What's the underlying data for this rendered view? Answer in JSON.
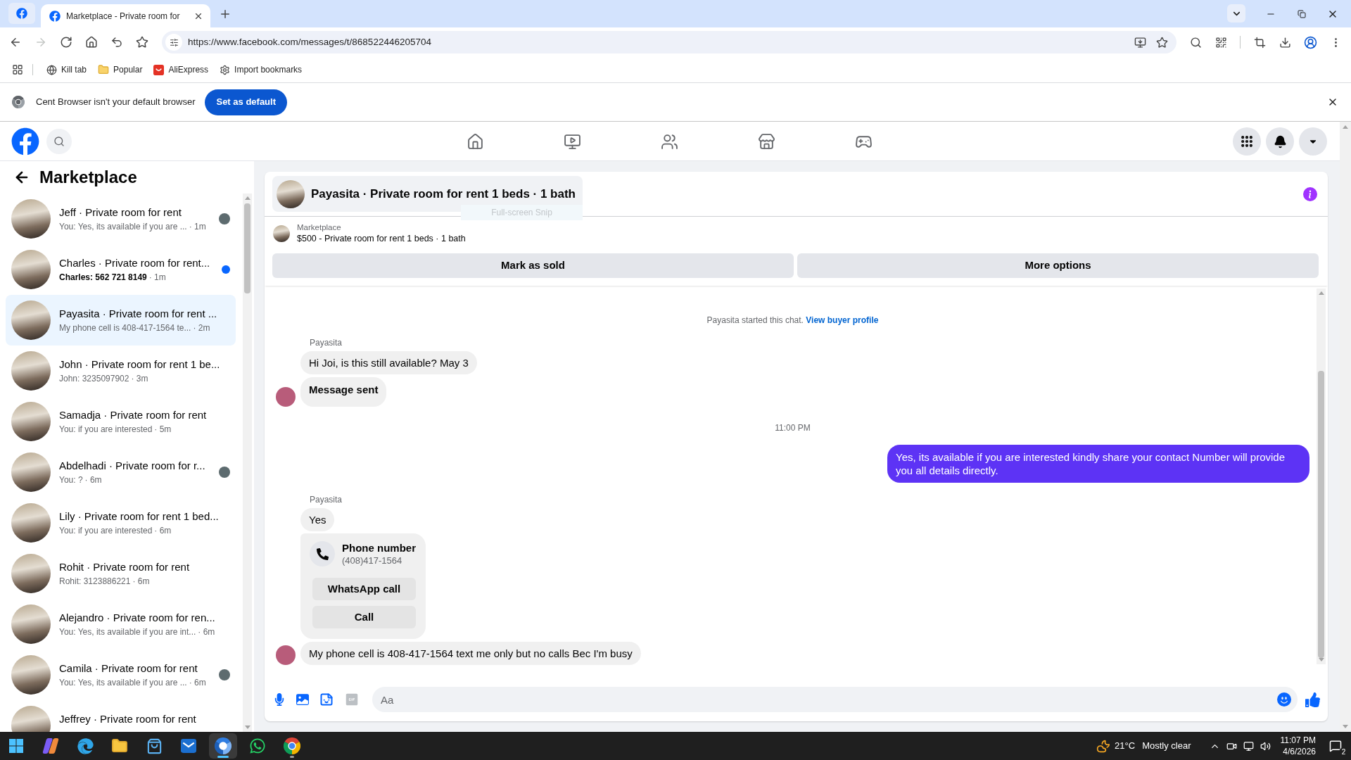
{
  "browser": {
    "tabs": [
      {
        "kind": "pinned",
        "selected": false
      },
      {
        "kind": "page",
        "title": "Marketplace - Private room for",
        "selected": true
      }
    ],
    "navigation": [
      {
        "kind": "back",
        "disabled": false
      },
      {
        "kind": "forward",
        "disabled": true
      },
      {
        "kind": "reload",
        "disabled": false
      },
      {
        "kind": "home",
        "disabled": false
      },
      {
        "kind": "undo",
        "disabled": false
      },
      {
        "kind": "bookmark",
        "disabled": false
      }
    ],
    "url": "https://www.facebook.com/messages/t/868522446205704",
    "bookmarks": [
      {
        "kind": "globe",
        "label": "Kill tab"
      },
      {
        "kind": "folder",
        "label": "Popular"
      },
      {
        "kind": "shop",
        "label": "AliExpress"
      },
      {
        "kind": "gear",
        "label": "Import bookmarks"
      }
    ],
    "infobar": {
      "message": "Cent Browser isn't your default browser",
      "button": "Set as default"
    }
  },
  "facebook_nav": [
    {
      "kind": "home"
    },
    {
      "kind": "video"
    },
    {
      "kind": "friends"
    },
    {
      "kind": "marketplace"
    },
    {
      "kind": "gaming"
    }
  ],
  "sidebar": {
    "title": "Marketplace",
    "conversations": [
      {
        "name": "Jeff · Private room for rent",
        "preview": "You: Yes, its available if you are ...",
        "time": "· 1m",
        "selected": false,
        "unread": false,
        "seen": true
      },
      {
        "name": "Charles · Private room for rent...",
        "preview": "Charles: 562 721 8149",
        "time": "· 1m",
        "selected": false,
        "unread": true,
        "seen": false
      },
      {
        "name": "Payasita · Private room for rent ...",
        "preview": "My phone cell is 408-417-1564 te...",
        "time": "· 2m",
        "selected": true,
        "unread": false,
        "seen": false
      },
      {
        "name": "John · Private room for rent 1 be...",
        "preview": "John: 3235097902",
        "time": "· 3m",
        "selected": false,
        "unread": false,
        "seen": false
      },
      {
        "name": "Samadja · Private room for rent",
        "preview": "You: if you are interested",
        "time": "· 5m",
        "selected": false,
        "unread": false,
        "seen": false
      },
      {
        "name": "Abdelhadi · Private room for r...",
        "preview": "You: ?",
        "time": "· 6m",
        "selected": false,
        "unread": false,
        "seen": true
      },
      {
        "name": "Lily · Private room for rent 1 bed...",
        "preview": "You: if you are interested",
        "time": "· 6m",
        "selected": false,
        "unread": false,
        "seen": false
      },
      {
        "name": "Rohit · Private room for rent",
        "preview": "Rohit: 3123886221",
        "time": "· 6m",
        "selected": false,
        "unread": false,
        "seen": false
      },
      {
        "name": "Alejandro · Private room for ren...",
        "preview": "You: Yes, its available if you are int...",
        "time": "· 6m",
        "selected": false,
        "unread": false,
        "seen": false
      },
      {
        "name": "Camila · Private room for rent",
        "preview": "You: Yes, its available if you are ...",
        "time": "· 6m",
        "selected": false,
        "unread": false,
        "seen": true
      },
      {
        "name": "Jeffrey · Private room for rent",
        "selected": false,
        "unread": false,
        "seen": false
      }
    ]
  },
  "chat": {
    "title": "Payasita · Private room for rent 1 beds · 1 bath",
    "tooltip": "Full-screen Snip",
    "listing": {
      "source": "Marketplace",
      "description": "$500 - Private room for rent 1 beds · 1 bath"
    },
    "actions": [
      "Mark as sold",
      "More options"
    ],
    "messages": [
      {
        "kind": "intro",
        "text": "Payasita started this chat.",
        "link": "View buyer profile"
      },
      {
        "kind": "sender",
        "text": "Payasita"
      },
      {
        "kind": "incoming",
        "text": "Hi Joi, is this still available? May 3",
        "bold": false,
        "show_avatar": false
      },
      {
        "kind": "incoming",
        "text": "Message sent",
        "bold": true,
        "show_avatar": true
      },
      {
        "kind": "timestamp",
        "text": "11:00 PM"
      },
      {
        "kind": "outgoing",
        "text": "Yes, its available if you are interested kindly share your contact Number will provide you all details directly."
      },
      {
        "kind": "sender",
        "text": "Payasita"
      },
      {
        "kind": "incoming",
        "text": "Yes",
        "bold": false,
        "show_avatar": false
      },
      {
        "kind": "phone_card",
        "title": "Phone number",
        "number": "(408)417-1564",
        "buttons": [
          "WhatsApp call",
          "Call"
        ]
      },
      {
        "kind": "incoming",
        "text": "My phone cell is 408-417-1564 text me only but no calls Bec I'm busy",
        "bold": false,
        "show_avatar": true
      }
    ],
    "composer": {
      "placeholder": "Aa"
    }
  },
  "taskbar": {
    "apps": [
      {
        "kind": "start",
        "selected": false,
        "running": false
      },
      {
        "kind": "assistant",
        "selected": false,
        "running": false
      },
      {
        "kind": "edge",
        "selected": false,
        "running": false
      },
      {
        "kind": "explorer",
        "selected": false,
        "running": false
      },
      {
        "kind": "store",
        "selected": false,
        "running": false
      },
      {
        "kind": "mail",
        "selected": false,
        "running": false
      },
      {
        "kind": "cent",
        "selected": true,
        "running": true
      },
      {
        "kind": "whatsapp",
        "selected": false,
        "running": false
      },
      {
        "kind": "chrome",
        "selected": false,
        "running": true
      }
    ],
    "weather": {
      "temperature": "21°C",
      "condition": "Mostly clear"
    },
    "clock": {
      "time": "11:07 PM",
      "date": "4/6/2026"
    },
    "notifications": "2"
  }
}
